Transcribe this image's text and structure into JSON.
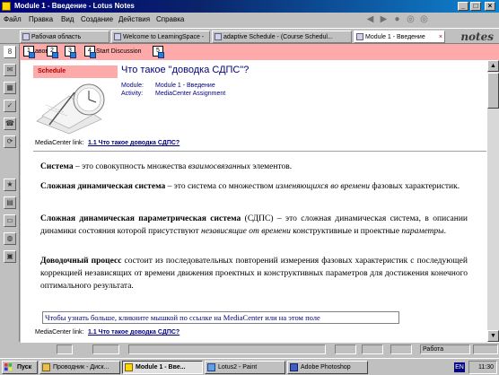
{
  "window": {
    "title": "Module 1 - Введение - Lotus Notes"
  },
  "menu": [
    "Файл",
    "Правка",
    "Вид",
    "Создание",
    "Действия",
    "Справка"
  ],
  "brand": "notes",
  "tabs": [
    {
      "label": "Рабочая область"
    },
    {
      "label": "Welcome to LearningSpace -"
    },
    {
      "label": "adaptive Schedule - (Course Schedul..."
    },
    {
      "label": "Module 1 - Введение"
    }
  ],
  "actions": [
    {
      "num": "1",
      "label": "авов"
    },
    {
      "num": "2",
      "label": ""
    },
    {
      "num": "3",
      "label": ""
    },
    {
      "num": "4",
      "label": "Start Discussion"
    },
    {
      "num": "5",
      "label": ""
    }
  ],
  "doc": {
    "section_label": "Schedule",
    "title": "Что такое \"доводка СДПС\"?",
    "module_label": "Module:",
    "module_value": "Module 1 - Введение",
    "activity_label": "Activity:",
    "activity_value": "MediaCenter Assignment",
    "mc_label": "MediaCenter link:",
    "mc_link": "1.1 Что такое доводка СДПС?",
    "p1_term": "Система",
    "p1_a": " – это совокупность множества ",
    "p1_i": "взаимосвязанных",
    "p1_b": " элементов.",
    "p2_term": "Сложная динамическая система",
    "p2_a": " – это система со множеством ",
    "p2_i": "изменяющихся во времени",
    "p2_b": " фазовых характеристик.",
    "p3_term": "Сложная динамическая параметрическая система",
    "p3_a": " (СДПС) – это сложная динамическая система, в описании динамики состояния которой присутствуют ",
    "p3_i1": "независящие от времени",
    "p3_b": " конструктивные и проектные ",
    "p3_i2": "параметры",
    "p3_c": ".",
    "p4_term": "Доводочный процесс",
    "p4_a": " состоит из последовательных повторений измерения фазовых характеристик с последующей коррекцией независящих от времени движения проектных и конструктивных параметров для достижения конечного оптимального результата.",
    "note": "Чтобы узнать больше, кликните мышкой по ссылке на MediaCenter или на этом поле"
  },
  "status": {
    "work": "Работа"
  },
  "taskbar": {
    "start": "Пуск",
    "items": [
      {
        "label": "Проводник - Диск..."
      },
      {
        "label": "Module 1 - Вве..."
      },
      {
        "label": "Lotus2 - Paint"
      },
      {
        "label": "Adobe Photoshop"
      }
    ],
    "lang": "EN",
    "clock": "11:30"
  }
}
